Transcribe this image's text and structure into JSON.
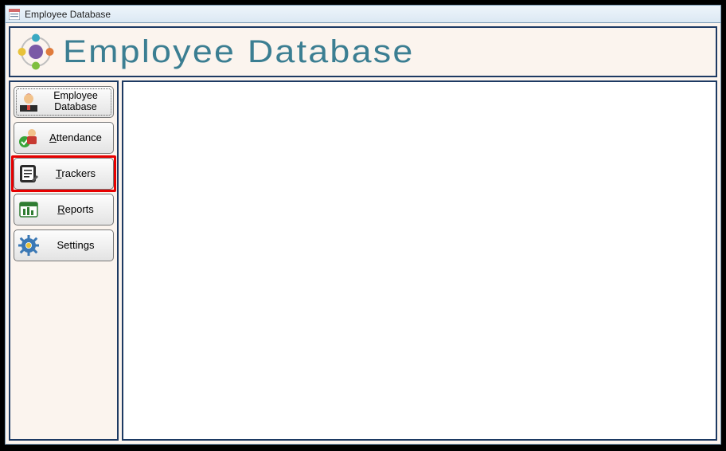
{
  "titlebar": {
    "title": "Employee Database"
  },
  "banner": {
    "title": "Employee Database"
  },
  "sidebar": {
    "items": [
      {
        "label": "Employee Database",
        "accel_index": -1
      },
      {
        "label": "Attendance",
        "accel_index": 0
      },
      {
        "label": "Trackers",
        "accel_index": 0
      },
      {
        "label": "Reports",
        "accel_index": 0
      },
      {
        "label": "Settings",
        "accel_index": -1
      }
    ],
    "selected": 2,
    "focused": 0
  }
}
